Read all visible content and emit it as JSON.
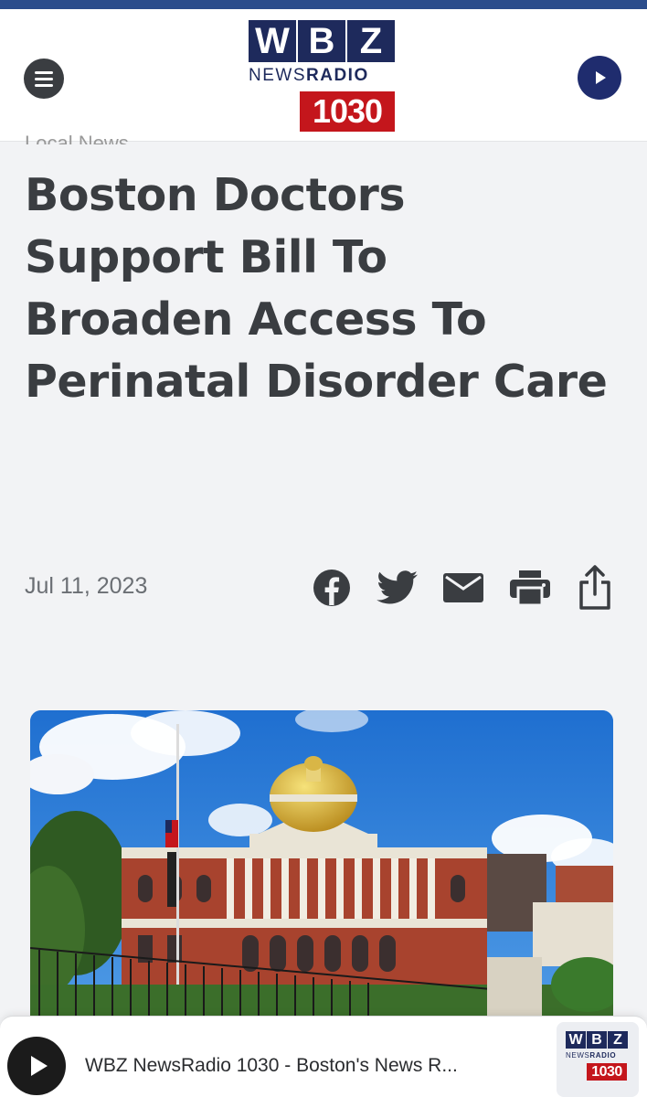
{
  "header": {
    "menu_icon": "hamburger-icon",
    "play_icon": "play-icon",
    "logo": {
      "letters": [
        "W",
        "B",
        "Z"
      ],
      "news": "NEWS",
      "radio": "RADIO",
      "number": "1030"
    }
  },
  "article": {
    "category": "Local News",
    "headline": "Boston Doctors Support Bill To Broaden Access To Perinatal Disorder Care",
    "date": "Jul 11, 2023",
    "share_icons": [
      "facebook-icon",
      "twitter-icon",
      "email-icon",
      "print-icon",
      "share-icon"
    ]
  },
  "colors": {
    "brand_navy": "#1e2a5c",
    "brand_red": "#c4161c",
    "text": "#3a3d41",
    "background": "#f2f3f5"
  },
  "player": {
    "title": "WBZ NewsRadio 1030 - Boston's News R...",
    "play_icon": "play-icon"
  }
}
